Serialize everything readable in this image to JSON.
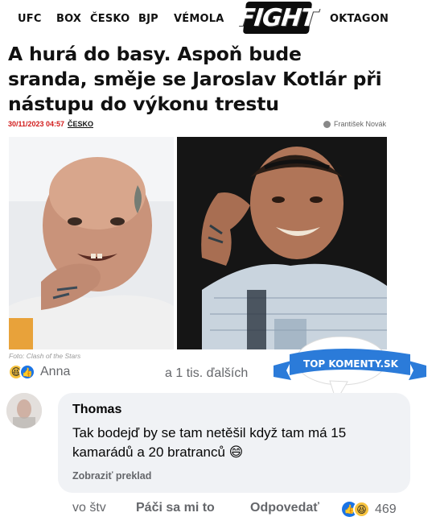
{
  "nav": {
    "items": [
      "UFC",
      "BOX",
      "ČESKO",
      "BJP",
      "VÉMOLA",
      "OKTAGON"
    ],
    "logo": "FIGHT"
  },
  "article": {
    "headline": "A hurá do basy. Aspoň bude sranda, směje se Jaroslav Kotlár při nástupu do výkonu trestu",
    "date": "30/11/2023 04:57",
    "category": "ČESKO",
    "author": "František Novák",
    "photo_credit": "Foto: Clash of the Stars"
  },
  "reactions": {
    "name": "Anna",
    "more": "a 1 tis. ďalších"
  },
  "badge": {
    "text": "TOP KOMENTY.SK",
    "color": "#2b7bd9"
  },
  "comment": {
    "author": "Thomas",
    "text": "Tak bodejď by se tam netěšil když tam má 15 kamarádů a 20 bratranců 😄",
    "translate": "Zobraziť preklad",
    "time": "vo štv",
    "like": "Páči sa mi to",
    "reply": "Odpovedať",
    "reaction_count": "469"
  },
  "colors": {
    "accent_red": "#d11b1b",
    "fb_blue": "#1b74e4",
    "bubble": "#f0f2f5",
    "muted": "#65676b"
  }
}
